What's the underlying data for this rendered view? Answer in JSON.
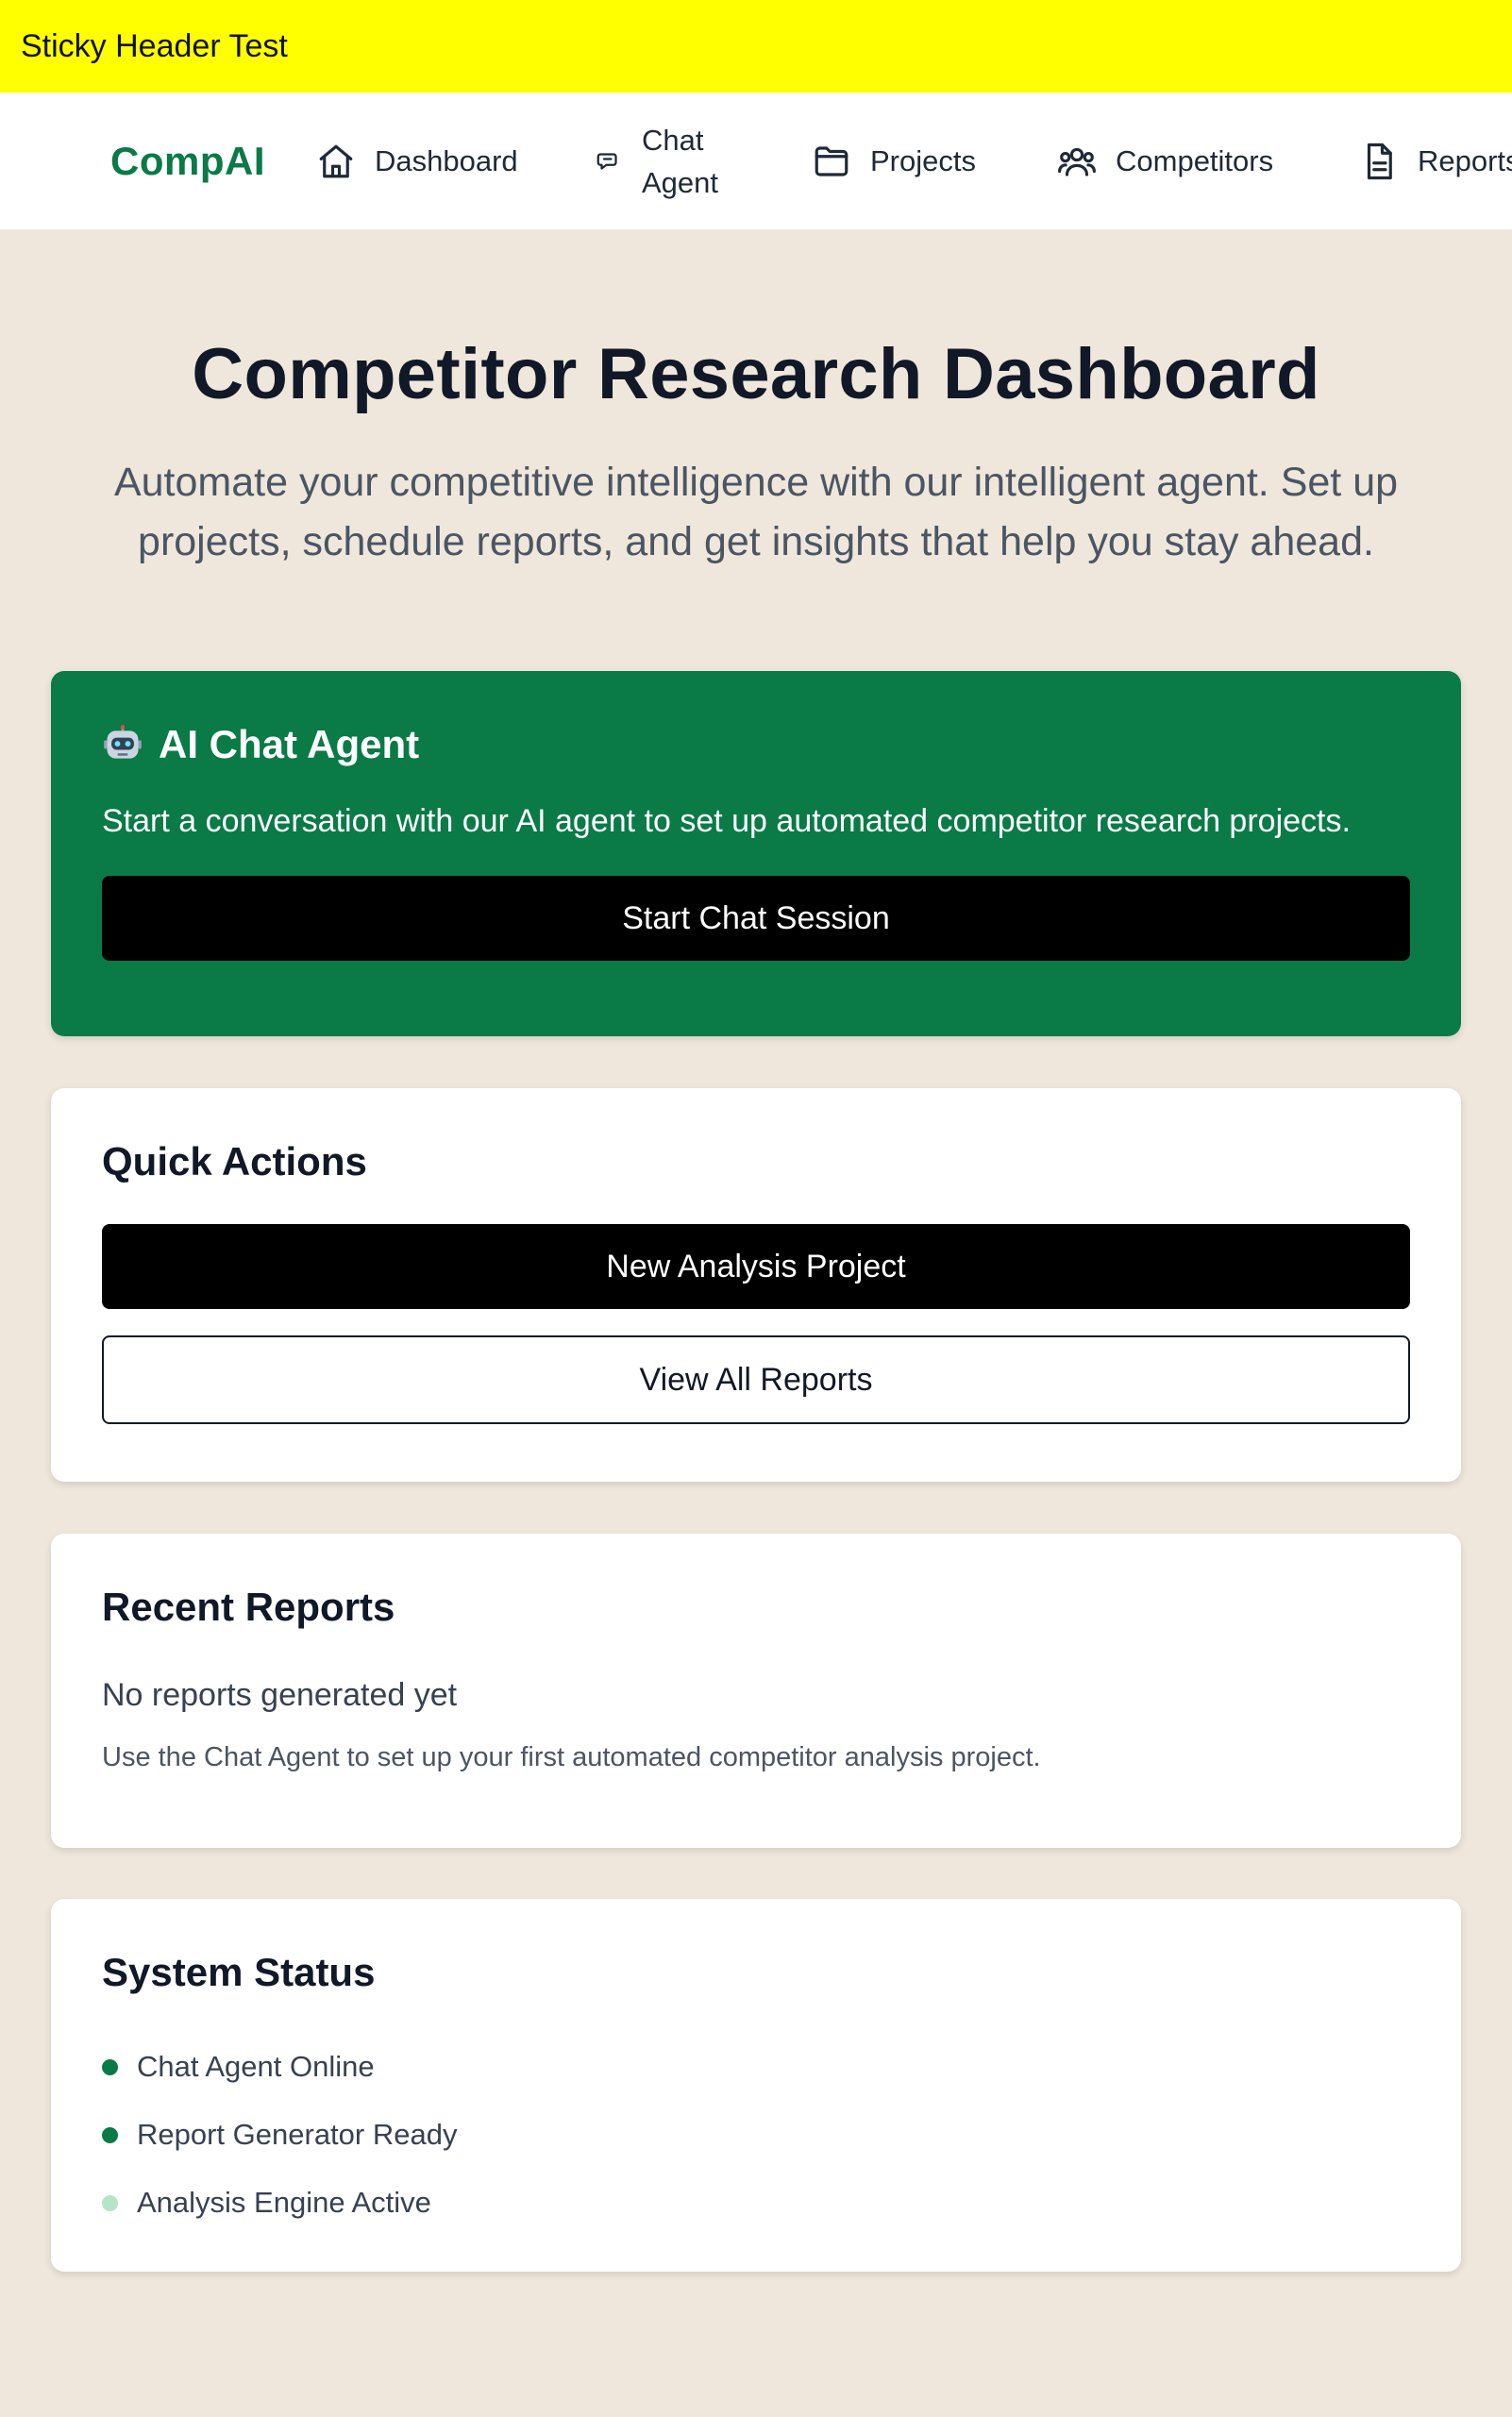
{
  "sticky_header": {
    "text": "Sticky Header Test"
  },
  "nav": {
    "brand": "CompAI",
    "items": [
      {
        "label": "Dashboard",
        "icon": "home-icon"
      },
      {
        "label": "Chat Agent",
        "icon": "chat-icon"
      },
      {
        "label": "Projects",
        "icon": "folder-icon"
      },
      {
        "label": "Competitors",
        "icon": "users-icon"
      },
      {
        "label": "Reports",
        "icon": "document-icon"
      }
    ]
  },
  "hero": {
    "title": "Competitor Research Dashboard",
    "subtitle": "Automate your competitive intelligence with our intelligent agent. Set up projects, schedule reports, and get insights that help you stay ahead."
  },
  "chat_card": {
    "icon": "robot-icon",
    "title": "AI Chat Agent",
    "description": "Start a conversation with our AI agent to set up automated competitor research projects.",
    "button_label": "Start Chat Session"
  },
  "quick_actions": {
    "title": "Quick Actions",
    "primary_label": "New Analysis Project",
    "secondary_label": "View All Reports"
  },
  "recent_reports": {
    "title": "Recent Reports",
    "empty_title": "No reports generated yet",
    "empty_description": "Use the Chat Agent to set up your first automated competitor analysis project."
  },
  "system_status": {
    "title": "System Status",
    "items": [
      {
        "label": "Chat Agent Online",
        "color": "#0a7a47"
      },
      {
        "label": "Report Generator Ready",
        "color": "#0a7a47"
      },
      {
        "label": "Analysis Engine Active",
        "color": "#b7e4c7"
      }
    ]
  },
  "colors": {
    "brand": "#0a7a47",
    "sticky_header_bg": "#ffff00",
    "page_bg": "#efe7dc"
  }
}
